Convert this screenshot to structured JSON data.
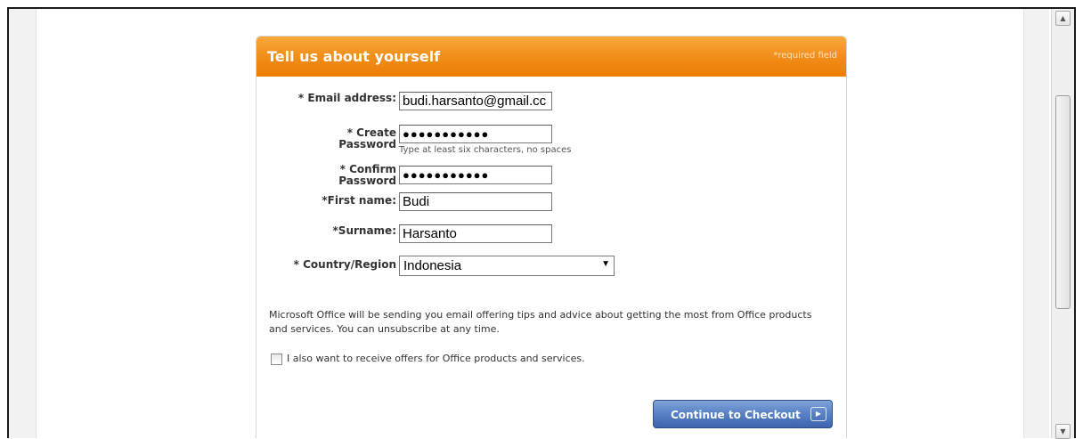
{
  "header": {
    "title": "Tell us about yourself",
    "required_note": "*required field"
  },
  "form": {
    "email": {
      "label": "* Email address:",
      "value": "budi.harsanto@gmail.cc"
    },
    "create_password": {
      "label_line1": "* Create",
      "label_line2": "Password",
      "value": "●●●●●●●●●●●",
      "hint": "Type at least six characters, no spaces"
    },
    "confirm_password": {
      "label_line1": "* Confirm",
      "label_line2": "Password",
      "value": "●●●●●●●●●●●"
    },
    "first_name": {
      "label": "*First name:",
      "value": "Budi"
    },
    "surname": {
      "label": "*Surname:",
      "value": "Harsanto"
    },
    "country": {
      "label": "* Country/Region",
      "value": "Indonesia"
    }
  },
  "info_text": "Microsoft Office will be sending you email offering tips and advice about getting the most from Office products and services. You can unsubscribe at any time.",
  "offers_checkbox": {
    "label": "I also want to receive offers for Office products and services.",
    "checked": false
  },
  "checkout_button": {
    "label": "Continue to Checkout"
  },
  "colors": {
    "header_orange": "#f18e1a",
    "button_blue": "#4a71b8"
  }
}
